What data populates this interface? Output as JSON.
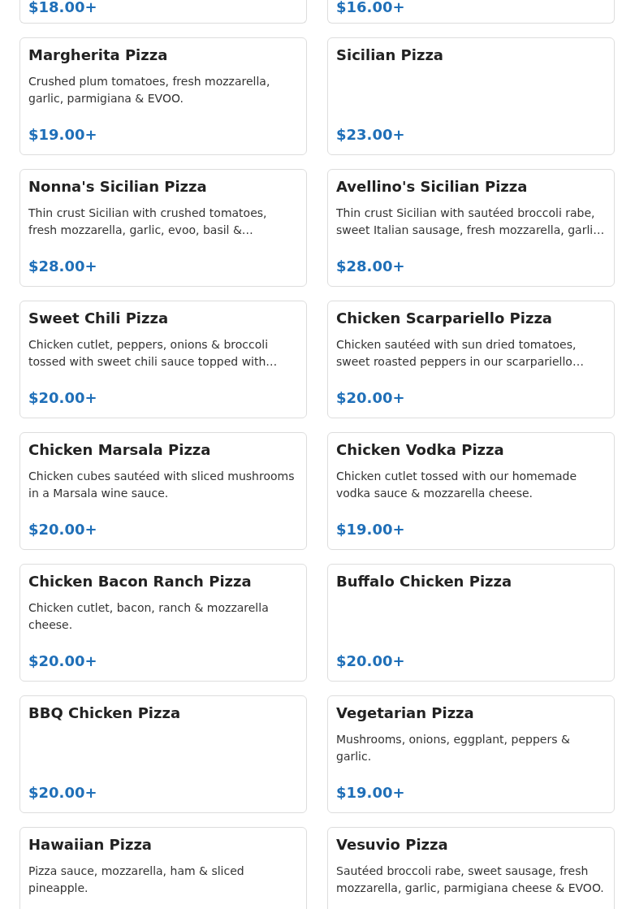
{
  "items": [
    {
      "price": "$18.00+"
    },
    {
      "price": "$16.00+"
    },
    {
      "name": "Margherita Pizza",
      "description": "Crushed plum tomatoes, fresh mozzarella, garlic, parmigiana & EVOO.",
      "price": "$19.00+"
    },
    {
      "name": "Sicilian Pizza",
      "price": "$23.00+"
    },
    {
      "name": "Nonna's Sicilian Pizza",
      "description": "Thin crust Sicilian with crushed tomatoes, fresh mozzarella, garlic, evoo, basil &…",
      "price": "$28.00+"
    },
    {
      "name": "Avellino's Sicilian Pizza",
      "description": "Thin crust Sicilian with sautéed broccoli rabe, sweet Italian sausage, fresh mozzarella, garli…",
      "price": "$28.00+"
    },
    {
      "name": "Sweet Chili Pizza",
      "description": "Chicken cutlet, peppers, onions & broccoli tossed with sweet chili sauce topped with…",
      "price": "$20.00+"
    },
    {
      "name": "Chicken Scarpariello Pizza",
      "description": "Chicken sautéed with sun dried tomatoes, sweet roasted peppers in our scarpariello…",
      "price": "$20.00+"
    },
    {
      "name": "Chicken Marsala Pizza",
      "description": "Chicken cubes sautéed with sliced mushrooms in a Marsala wine sauce.",
      "price": "$20.00+"
    },
    {
      "name": "Chicken Vodka Pizza",
      "description": "Chicken cutlet tossed with our homemade vodka sauce & mozzarella cheese.",
      "price": "$19.00+"
    },
    {
      "name": "Chicken Bacon Ranch Pizza",
      "description": "Chicken cutlet, bacon, ranch & mozzarella cheese.",
      "price": "$20.00+"
    },
    {
      "name": "Buffalo Chicken Pizza",
      "price": "$20.00+"
    },
    {
      "name": "BBQ Chicken Pizza",
      "price": "$20.00+"
    },
    {
      "name": "Vegetarian Pizza",
      "description": "Mushrooms, onions, eggplant, peppers & garlic.",
      "price": "$19.00+"
    },
    {
      "name": "Hawaiian Pizza",
      "description": "Pizza sauce, mozzarella, ham & sliced pineapple."
    },
    {
      "name": "Vesuvio Pizza",
      "description": "Sautéed broccoli rabe, sweet sausage, fresh mozzarella, garlic, parmigiana cheese & EVOO."
    }
  ]
}
